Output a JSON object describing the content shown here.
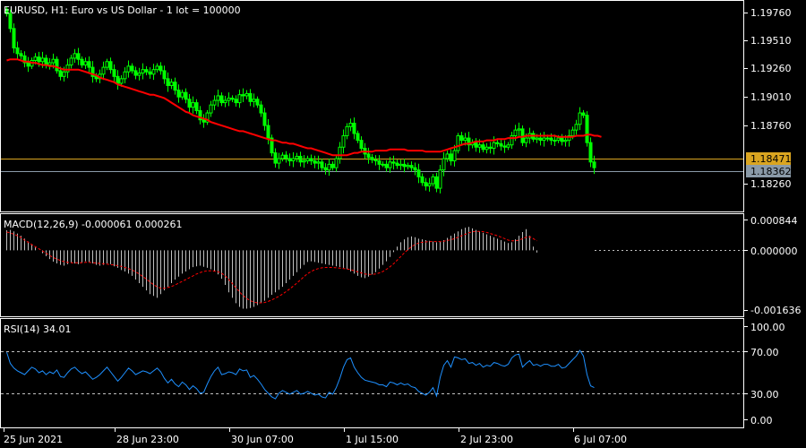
{
  "main_panel": {
    "header": "EURUSD, H1:  Euro vs US Dollar - 1 lot = 100000",
    "y_ticks": [
      "1.19760",
      "1.19510",
      "1.19260",
      "1.19010",
      "1.18760",
      "1.18260"
    ],
    "bid_label": "1.18471",
    "ask_label": "1.18362"
  },
  "macd_panel": {
    "header": "MACD(12,26,9) -0.000061 0.000261",
    "y_ticks": [
      "0.000844",
      "0.000000",
      "-0.001636"
    ]
  },
  "rsi_panel": {
    "header": "RSI(14) 34.01",
    "y_ticks": [
      "100.00",
      "70.00",
      "30.00",
      "0.00"
    ]
  },
  "x_axis": {
    "labels": [
      "25 Jun 2021",
      "28 Jun 23:00",
      "30 Jun 07:00",
      "1 Jul 15:00",
      "2 Jul 23:00",
      "6 Jul 07:00"
    ]
  },
  "colors": {
    "background": "#000000",
    "candle": "#00ff00",
    "ma": "#ff0000",
    "bid_line": "#daa520",
    "ask_line": "#8a9aa8",
    "rsi_line": "#1e90ff",
    "macd_hist": "#c0c0c0",
    "macd_signal": "#ff0000",
    "axis_text": "#ffffff",
    "frame": "#ffffff"
  },
  "chart_data": [
    {
      "type": "candlestick",
      "name": "EURUSD H1",
      "ylim": [
        1.1813,
        1.1985
      ],
      "grid": false,
      "legend": "none",
      "price_series": [
        1.1975,
        1.1962,
        1.1945,
        1.194,
        1.1938,
        1.1932,
        1.1929,
        1.1934,
        1.1937,
        1.1933,
        1.1936,
        1.193,
        1.1932,
        1.1935,
        1.1925,
        1.192,
        1.1924,
        1.193,
        1.1936,
        1.194,
        1.1935,
        1.193,
        1.1933,
        1.1928,
        1.192,
        1.1918,
        1.1922,
        1.1928,
        1.1933,
        1.1926,
        1.192,
        1.1914,
        1.1918,
        1.1924,
        1.1929,
        1.1925,
        1.1921,
        1.1923,
        1.1926,
        1.1924,
        1.1922,
        1.1926,
        1.1929,
        1.1925,
        1.1918,
        1.1912,
        1.1915,
        1.1908,
        1.1902,
        1.1906,
        1.19,
        1.1893,
        1.1897,
        1.189,
        1.1882,
        1.188,
        1.1888,
        1.1895,
        1.1899,
        1.1903,
        1.1897,
        1.1899,
        1.1901,
        1.19,
        1.1897,
        1.1904,
        1.1903,
        1.1905,
        1.1898,
        1.19,
        1.1895,
        1.1888,
        1.1877,
        1.1866,
        1.1853,
        1.1844,
        1.1848,
        1.1851,
        1.1848,
        1.1846,
        1.1848,
        1.185,
        1.1845,
        1.1846,
        1.1848,
        1.1846,
        1.1844,
        1.1845,
        1.184,
        1.1838,
        1.1843,
        1.184,
        1.1848,
        1.1858,
        1.1868,
        1.1876,
        1.1879,
        1.187,
        1.1864,
        1.1857,
        1.1852,
        1.1849,
        1.1847,
        1.1846,
        1.1843,
        1.1843,
        1.184,
        1.1845,
        1.1844,
        1.1842,
        1.1843,
        1.1841,
        1.1842,
        1.184,
        1.1838,
        1.1832,
        1.1827,
        1.1824,
        1.1826,
        1.1832,
        1.1822,
        1.1838,
        1.1848,
        1.1852,
        1.1846,
        1.1855,
        1.1868,
        1.1864,
        1.1866,
        1.186,
        1.1862,
        1.1858,
        1.186,
        1.1856,
        1.1858,
        1.1857,
        1.1862,
        1.1861,
        1.1859,
        1.1858,
        1.186,
        1.1868,
        1.1873,
        1.1874,
        1.1862,
        1.1866,
        1.187,
        1.1865,
        1.1866,
        1.1864,
        1.1866,
        1.1866,
        1.1864,
        1.1864,
        1.1866,
        1.1863,
        1.1864,
        1.1868,
        1.1873,
        1.1878,
        1.1888,
        1.1886,
        1.1862,
        1.1845,
        1.184
      ],
      "ma_series": [
        1.1934,
        1.1935,
        1.1935,
        1.1935,
        1.1934,
        1.1933,
        1.1933,
        1.1932,
        1.1932,
        1.1931,
        1.193,
        1.193,
        1.1929,
        1.1929,
        1.1928,
        1.1927,
        1.1926,
        1.1926,
        1.1926,
        1.1926,
        1.1926,
        1.1925,
        1.1924,
        1.1923,
        1.1922,
        1.1921,
        1.1919,
        1.1918,
        1.1917,
        1.1916,
        1.1915,
        1.1913,
        1.1912,
        1.1911,
        1.191,
        1.1909,
        1.1908,
        1.1907,
        1.1906,
        1.1905,
        1.1904,
        1.1904,
        1.1903,
        1.1902,
        1.1901,
        1.1899,
        1.1897,
        1.1895,
        1.1893,
        1.1891,
        1.1889,
        1.1888,
        1.1886,
        1.1885,
        1.1884,
        1.1883,
        1.1882,
        1.188,
        1.1879,
        1.1878,
        1.1877,
        1.1876,
        1.1875,
        1.1874,
        1.1873,
        1.1872,
        1.1872,
        1.1871,
        1.187,
        1.1869,
        1.1868,
        1.1867,
        1.1866,
        1.1865,
        1.1864,
        1.1864,
        1.1863,
        1.1862,
        1.1862,
        1.1861,
        1.1861,
        1.186,
        1.1859,
        1.1858,
        1.1857,
        1.1857,
        1.1856,
        1.1855,
        1.1854,
        1.1853,
        1.1852,
        1.1851,
        1.1851,
        1.1851,
        1.1851,
        1.1851,
        1.1852,
        1.1853,
        1.1853,
        1.1854,
        1.1854,
        1.1854,
        1.1854,
        1.1855,
        1.1855,
        1.1855,
        1.1855,
        1.1856,
        1.1856,
        1.1856,
        1.1856,
        1.1856,
        1.1855,
        1.1855,
        1.1855,
        1.1855,
        1.1855,
        1.1854,
        1.1854,
        1.1854,
        1.1854,
        1.1854,
        1.1855,
        1.1856,
        1.1857,
        1.1858,
        1.1859,
        1.186,
        1.1861,
        1.1861,
        1.1862,
        1.1863,
        1.1863,
        1.1863,
        1.1864,
        1.1864,
        1.1864,
        1.1865,
        1.1865,
        1.1865,
        1.1866,
        1.1866,
        1.1866,
        1.1867,
        1.1867,
        1.1868,
        1.1868,
        1.1868,
        1.1868,
        1.1868,
        1.1868,
        1.1868,
        1.1868,
        1.1868,
        1.1867,
        1.1867,
        1.1867,
        1.1867,
        1.1867,
        1.1868,
        1.1868,
        1.1868,
        1.1869,
        1.1869,
        1.1868,
        1.1868,
        1.1867
      ]
    },
    {
      "type": "bar",
      "name": "MACD(12,26,9)",
      "ylim": [
        -0.001636,
        0.000844
      ],
      "histogram": [
        0.00055,
        0.00056,
        0.00052,
        0.00046,
        0.0004,
        0.00032,
        0.00024,
        0.00016,
        8e-05,
        0.0,
        -8e-05,
        -0.00016,
        -0.00024,
        -0.00031,
        -0.00036,
        -0.0004,
        -0.00042,
        -0.00038,
        -0.00034,
        -0.00036,
        -0.00038,
        -0.00034,
        -0.0003,
        -0.00032,
        -0.00036,
        -0.0004,
        -0.00042,
        -0.0004,
        -0.00036,
        -0.00038,
        -0.00044,
        -0.00048,
        -0.00054,
        -0.00058,
        -0.00064,
        -0.0007,
        -0.0008,
        -0.0009,
        -0.001,
        -0.0011,
        -0.0012,
        -0.00125,
        -0.0013,
        -0.0012,
        -0.0011,
        -0.001,
        -0.0009,
        -0.0008,
        -0.00072,
        -0.00064,
        -0.00058,
        -0.00052,
        -0.00046,
        -0.00044,
        -0.00042,
        -0.00045,
        -0.00048,
        -0.00052,
        -0.00058,
        -0.00066,
        -0.00078,
        -0.00095,
        -0.00115,
        -0.0013,
        -0.00145,
        -0.00155,
        -0.0016,
        -0.0016,
        -0.00158,
        -0.00155,
        -0.0015,
        -0.00145,
        -0.00138,
        -0.0013,
        -0.00122,
        -0.00115,
        -0.00108,
        -0.001,
        -0.0009,
        -0.0008,
        -0.0007,
        -0.0006,
        -0.0005,
        -0.0004,
        -0.00032,
        -0.0003,
        -0.00032,
        -0.00034,
        -0.00036,
        -0.00038,
        -0.0004,
        -0.00042,
        -0.00044,
        -0.00046,
        -0.00048,
        -0.00052,
        -0.00058,
        -0.00064,
        -0.0007,
        -0.00074,
        -0.00076,
        -0.00072,
        -0.00066,
        -0.0006,
        -0.0005,
        -0.0004,
        -0.0003,
        -0.00018,
        -5e-05,
        0.0001,
        0.00022,
        0.0003,
        0.00036,
        0.00038,
        0.00036,
        0.00032,
        0.0003,
        0.00028,
        0.00026,
        0.00024,
        0.00022,
        0.00024,
        0.00028,
        0.00034,
        0.0004,
        0.00046,
        0.00052,
        0.00058,
        0.00062,
        0.00064,
        0.0006,
        0.00056,
        0.00052,
        0.00048,
        0.00044,
        0.0004,
        0.00036,
        0.00032,
        0.00028,
        0.00024,
        0.0002,
        0.00022,
        0.0003,
        0.0004,
        0.0005,
        0.00058,
        0.0004,
        0.0001,
        -6e-05
      ],
      "signal": [
        0.0005,
        0.00048,
        0.00044,
        0.0004,
        0.00035,
        0.00028,
        0.00022,
        0.00016,
        0.0001,
        4e-05,
        -2e-05,
        -8e-05,
        -0.00014,
        -0.0002,
        -0.00024,
        -0.00028,
        -0.00031,
        -0.00033,
        -0.00034,
        -0.00034,
        -0.00034,
        -0.00034,
        -0.00033,
        -0.00033,
        -0.00034,
        -0.00035,
        -0.00036,
        -0.00037,
        -0.00038,
        -0.00039,
        -0.0004,
        -0.00042,
        -0.00044,
        -0.00047,
        -0.0005,
        -0.00054,
        -0.00059,
        -0.00065,
        -0.00072,
        -0.00079,
        -0.00087,
        -0.00094,
        -0.001,
        -0.00104,
        -0.00104,
        -0.00102,
        -0.00099,
        -0.00095,
        -0.0009,
        -0.00085,
        -0.0008,
        -0.00075,
        -0.0007,
        -0.00065,
        -0.00061,
        -0.00058,
        -0.00056,
        -0.00056,
        -0.00057,
        -0.00059,
        -0.00063,
        -0.0007,
        -0.0008,
        -0.00091,
        -0.00103,
        -0.00114,
        -0.00124,
        -0.00132,
        -0.00138,
        -0.00142,
        -0.00144,
        -0.00144,
        -0.00143,
        -0.0014,
        -0.00136,
        -0.00131,
        -0.00126,
        -0.0012,
        -0.00113,
        -0.00106,
        -0.00098,
        -0.0009,
        -0.00081,
        -0.00072,
        -0.00064,
        -0.00058,
        -0.00053,
        -0.0005,
        -0.00048,
        -0.00047,
        -0.00047,
        -0.00047,
        -0.00048,
        -0.00049,
        -0.0005,
        -0.00051,
        -0.00053,
        -0.00056,
        -0.00059,
        -0.00062,
        -0.00065,
        -0.00066,
        -0.00066,
        -0.00065,
        -0.00062,
        -0.00058,
        -0.00052,
        -0.00045,
        -0.00037,
        -0.00027,
        -0.00017,
        -7e-05,
        2e-05,
        0.0001,
        0.00016,
        0.0002,
        0.00022,
        0.00023,
        0.00024,
        0.00024,
        0.00024,
        0.00024,
        0.00025,
        0.00027,
        0.00029,
        0.00032,
        0.00036,
        0.0004,
        0.00044,
        0.00048,
        0.00051,
        0.00052,
        0.00052,
        0.00051,
        0.00049,
        0.00046,
        0.00043,
        0.0004,
        0.00036,
        0.00032,
        0.00028,
        0.00026,
        0.00026,
        0.00028,
        0.00032,
        0.00036,
        0.00037,
        0.00032,
        0.00026
      ]
    },
    {
      "type": "line",
      "name": "RSI(14)",
      "ylim": [
        0,
        100
      ],
      "levels": [
        70,
        30
      ],
      "values": [
        72,
        60,
        55,
        52,
        50,
        48,
        52,
        56,
        54,
        50,
        52,
        48,
        51,
        49,
        53,
        46,
        45,
        50,
        54,
        56,
        52,
        49,
        51,
        47,
        43,
        45,
        48,
        52,
        56,
        51,
        46,
        41,
        45,
        50,
        55,
        52,
        48,
        50,
        52,
        51,
        49,
        52,
        55,
        51,
        44,
        39,
        43,
        38,
        35,
        40,
        37,
        32,
        36,
        33,
        28,
        29,
        38,
        46,
        52,
        56,
        48,
        49,
        51,
        50,
        48,
        54,
        52,
        53,
        45,
        47,
        43,
        38,
        32,
        28,
        24,
        22,
        28,
        31,
        29,
        27,
        29,
        31,
        27,
        28,
        30,
        28,
        26,
        27,
        24,
        23,
        29,
        27,
        34,
        44,
        56,
        64,
        66,
        56,
        50,
        45,
        42,
        41,
        40,
        39,
        37,
        37,
        35,
        40,
        39,
        37,
        39,
        37,
        38,
        35,
        34,
        30,
        28,
        26,
        29,
        34,
        25,
        45,
        58,
        63,
        56,
        67,
        66,
        64,
        65,
        60,
        61,
        58,
        60,
        56,
        58,
        57,
        61,
        60,
        58,
        57,
        59,
        66,
        69,
        70,
        56,
        60,
        63,
        58,
        59,
        57,
        59,
        59,
        57,
        57,
        59,
        55,
        56,
        60,
        64,
        68,
        74,
        68,
        48,
        36,
        34
      ]
    }
  ]
}
